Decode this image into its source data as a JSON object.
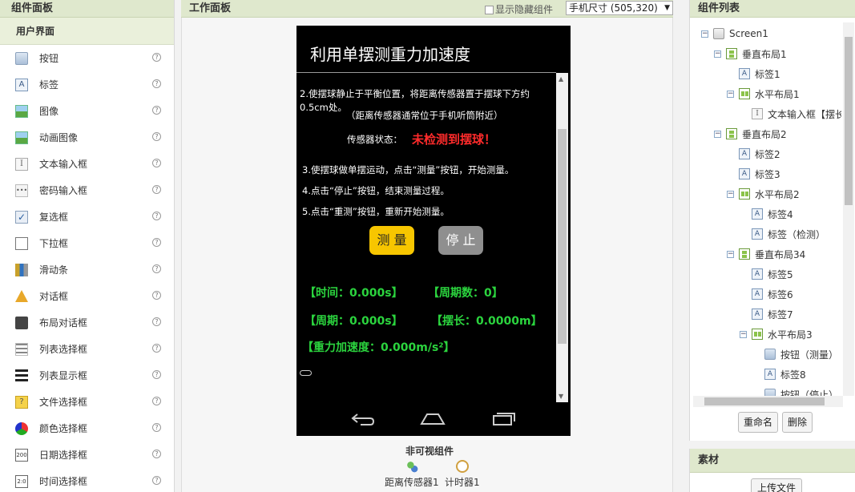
{
  "palette": {
    "title": "组件面板",
    "group": "用户界面",
    "help_glyph": "?",
    "items": [
      {
        "label": "按钮",
        "icon": "button-icon"
      },
      {
        "label": "标签",
        "icon": "label-icon"
      },
      {
        "label": "图像",
        "icon": "image-icon"
      },
      {
        "label": "动画图像",
        "icon": "animated-image-icon"
      },
      {
        "label": "文本输入框",
        "icon": "textbox-icon"
      },
      {
        "label": "密码输入框",
        "icon": "password-icon"
      },
      {
        "label": "复选框",
        "icon": "checkbox-icon"
      },
      {
        "label": "下拉框",
        "icon": "spinner-icon"
      },
      {
        "label": "滑动条",
        "icon": "slider-icon"
      },
      {
        "label": "对话框",
        "icon": "notifier-icon"
      },
      {
        "label": "布局对话框",
        "icon": "layout-dialog-icon"
      },
      {
        "label": "列表选择框",
        "icon": "listpicker-icon"
      },
      {
        "label": "列表显示框",
        "icon": "listview-icon"
      },
      {
        "label": "文件选择框",
        "icon": "filepicker-icon"
      },
      {
        "label": "颜色选择框",
        "icon": "colorpicker-icon"
      },
      {
        "label": "日期选择框",
        "icon": "datepicker-icon"
      },
      {
        "label": "时间选择框",
        "icon": "timepicker-icon"
      }
    ]
  },
  "viewer": {
    "title": "工作面板",
    "show_hidden_label": "显示隐藏组件",
    "size_select": "手机尺寸 (505,320)",
    "nonvisible_title": "非可视组件",
    "nonvisible": [
      "距离传感器1",
      "计时器1"
    ]
  },
  "phone": {
    "title": "利用单摆测重力加速度",
    "step2": "2.使摆球静止于平衡位置，将距离传感器置于摆球下方约0.5cm处。",
    "step2_note": "（距离传感器通常位于手机听筒附近）",
    "status_label": "传感器状态：",
    "status_value": "未检测到摆球！",
    "step3": "3.使摆球做单摆运动，点击“测量”按钮，开始测量。",
    "step4": "4.点击“停止”按钮，结束测量过程。",
    "step5": "5.点击“重测”按钮，重新开始测量。",
    "measure_button": "测 量",
    "stop_button": "停 止",
    "time_label": "【时间：0.000s】",
    "count_label": "【周期数：0】",
    "period_label": "【周期：0.000s】",
    "length_label": "【摆长：0.0000m】",
    "gravity_label": "【重力加速度：0.000m/s²】",
    "status_color": "#ff2b2b",
    "result_color": "#2bd43e",
    "measure_color": "#f7c600"
  },
  "tree": {
    "title": "组件列表",
    "nodes": [
      {
        "label": "Screen1",
        "icon": "screen-icon",
        "toggle": "−"
      },
      {
        "label": "垂直布局1",
        "icon": "vertical-layout-icon",
        "toggle": "−"
      },
      {
        "label": "标签1",
        "icon": "label-icon",
        "toggle": ""
      },
      {
        "label": "水平布局1",
        "icon": "horizontal-layout-icon",
        "toggle": "−"
      },
      {
        "label": "文本输入框【摆长",
        "icon": "textbox-icon",
        "toggle": ""
      },
      {
        "label": "垂直布局2",
        "icon": "vertical-layout-icon",
        "toggle": "−"
      },
      {
        "label": "标签2",
        "icon": "label-icon",
        "toggle": ""
      },
      {
        "label": "标签3",
        "icon": "label-icon",
        "toggle": ""
      },
      {
        "label": "水平布局2",
        "icon": "horizontal-layout-icon",
        "toggle": "−"
      },
      {
        "label": "标签4",
        "icon": "label-icon",
        "toggle": ""
      },
      {
        "label": "标签（检测）",
        "icon": "label-icon",
        "toggle": ""
      },
      {
        "label": "垂直布局34",
        "icon": "vertical-layout-icon",
        "toggle": "−"
      },
      {
        "label": "标签5",
        "icon": "label-icon",
        "toggle": ""
      },
      {
        "label": "标签6",
        "icon": "label-icon",
        "toggle": ""
      },
      {
        "label": "标签7",
        "icon": "label-icon",
        "toggle": ""
      },
      {
        "label": "水平布局3",
        "icon": "horizontal-layout-icon",
        "toggle": "−"
      },
      {
        "label": "按钮（测量）",
        "icon": "button-icon",
        "toggle": ""
      },
      {
        "label": "标签8",
        "icon": "label-icon",
        "toggle": ""
      },
      {
        "label": "按钮（停止）",
        "icon": "button-icon",
        "toggle": ""
      }
    ],
    "rename_button": "重命名",
    "delete_button": "删除"
  },
  "assets": {
    "title": "素材",
    "upload_button": "上传文件"
  }
}
